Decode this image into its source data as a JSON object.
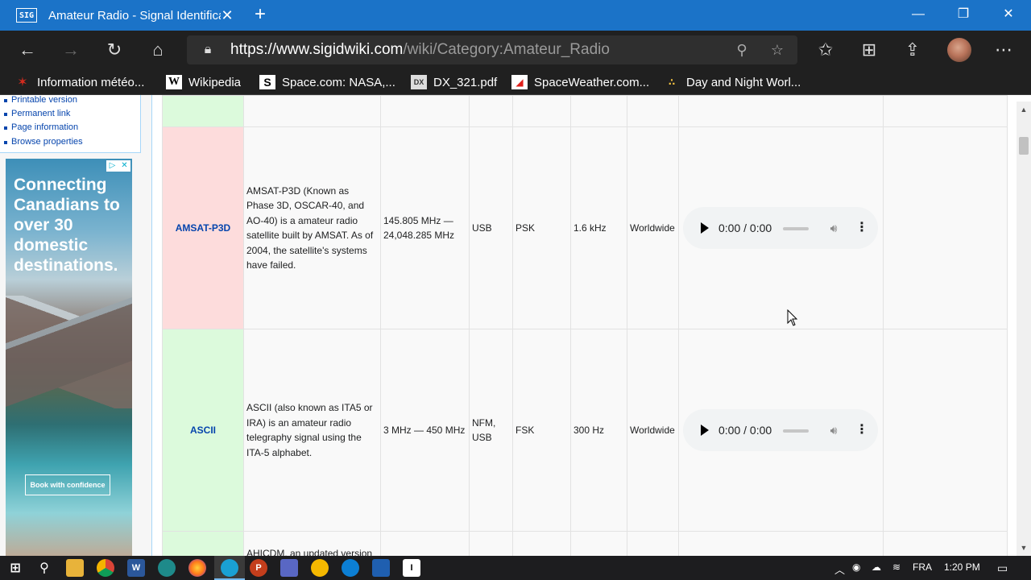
{
  "browser": {
    "tab_title": "Amateur Radio - Signal Identification",
    "tab_favicon": "SIG",
    "url_host": "https://www.sigidwiki.com",
    "url_path": "/wiki/Category:Amateur_Radio",
    "bookmarks": [
      {
        "label": "Information météo...",
        "icon": "maple-leaf-icon",
        "color": "#d52b1e"
      },
      {
        "label": "Wikipedia",
        "icon": "wikipedia-icon",
        "color": "#ffffff"
      },
      {
        "label": "Space.com: NASA,...",
        "icon": "space-com-icon",
        "color": "#ffffff"
      },
      {
        "label": "DX_321.pdf",
        "icon": "pdf-icon",
        "color": "#cfcfcf"
      },
      {
        "label": "SpaceWeather.com...",
        "icon": "spaceweather-icon",
        "color": "#e0201b"
      },
      {
        "label": "Day and Night Worl...",
        "icon": "day-night-icon",
        "color": "#f5c542"
      }
    ]
  },
  "sidebar": {
    "links": [
      "Printable version",
      "Permanent link",
      "Page information",
      "Browse properties"
    ]
  },
  "ad": {
    "headline": "Connecting Canadians to over 30 domestic destinations.",
    "cta": "Book with confidence",
    "choices": [
      "▷",
      "✕"
    ]
  },
  "table": {
    "rows": [
      {
        "name": "AMSAT-P3D",
        "color": "red",
        "description": "AMSAT-P3D (Known as Phase 3D, OSCAR-40, and AO-40) is a amateur radio satellite built by AMSAT. As of 2004, the satellite's systems have failed.",
        "frequency": "145.805 MHz — 24,048.285 MHz",
        "mode": "USB",
        "modulation": "PSK",
        "bandwidth": "1.6 kHz",
        "location": "Worldwide",
        "audio_time": "0:00 / 0:00"
      },
      {
        "name": "ASCII",
        "color": "green",
        "description": "ASCII (also known as ITA5 or IRA) is an amateur radio telegraphy signal using the ITA-5 alphabet.",
        "frequency": "3 MHz — 450 MHz",
        "mode": "NFM, USB",
        "modulation": "FSK",
        "bandwidth": "300 Hz",
        "location": "Worldwide",
        "audio_time": "0:00 / 0:00"
      }
    ],
    "next_row_description": "AHICDM, an updated version"
  },
  "taskbar": {
    "language": "FRA",
    "time": "1:20 PM"
  }
}
